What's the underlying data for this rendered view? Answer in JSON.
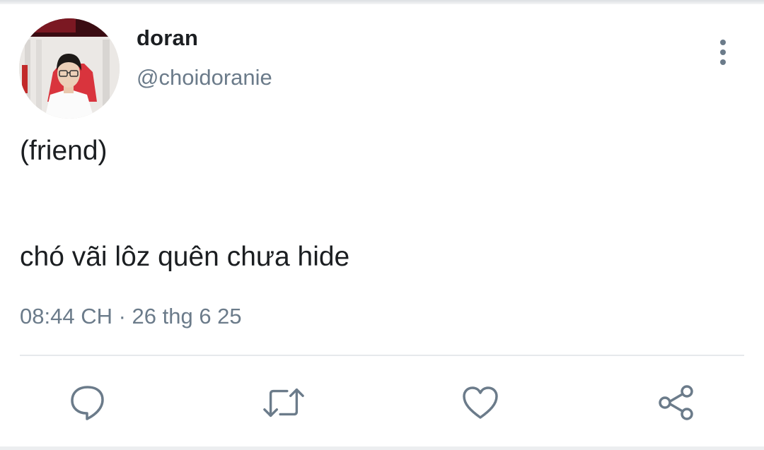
{
  "tweet": {
    "author": {
      "display_name": "doran",
      "handle": "@choidoranie",
      "avatar_icon": "profile-photo"
    },
    "text_lines": [
      "(friend)",
      "chó vãi lôz quên chưa hide"
    ],
    "timestamp": "08:44 CH · 26 thg 6 25"
  },
  "actions": [
    {
      "name": "reply",
      "icon": "speech-bubble-icon"
    },
    {
      "name": "retweet",
      "icon": "retweet-icon"
    },
    {
      "name": "like",
      "icon": "heart-icon"
    },
    {
      "name": "share",
      "icon": "share-icon"
    }
  ],
  "colors": {
    "text": "#1b1e21",
    "secondary": "#6b7b8a",
    "divider": "#e6e9ec"
  }
}
